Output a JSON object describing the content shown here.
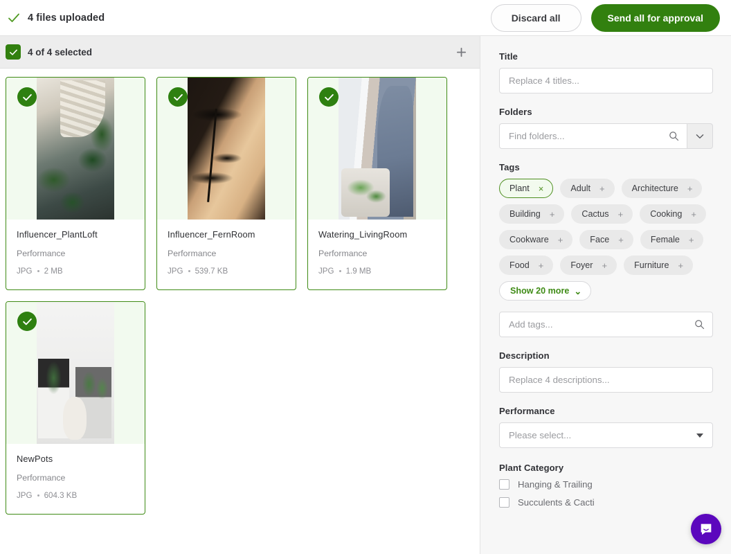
{
  "topbar": {
    "status_text": "4 files uploaded",
    "status_icon": "check-icon",
    "discard_label": "Discard all",
    "send_label": "Send all for approval",
    "accent_green": "#32800f"
  },
  "selection_bar": {
    "label": "4 of 4 selected",
    "checkbox_state": "checked",
    "add_icon": "plus-icon"
  },
  "cards": [
    {
      "title": "Influencer_PlantLoft",
      "subtitle": "Performance",
      "format": "JPG",
      "size": "2 MB",
      "selected": true
    },
    {
      "title": "Influencer_FernRoom",
      "subtitle": "Performance",
      "format": "JPG",
      "size": "539.7 KB",
      "selected": true
    },
    {
      "title": "Watering_LivingRoom",
      "subtitle": "Performance",
      "format": "JPG",
      "size": "1.9 MB",
      "selected": true
    },
    {
      "title": "NewPots",
      "subtitle": "Performance",
      "format": "JPG",
      "size": "604.3 KB",
      "selected": true
    }
  ],
  "panel": {
    "title": {
      "label": "Title",
      "placeholder": "Replace 4 titles..."
    },
    "folders": {
      "label": "Folders",
      "placeholder": "Find folders...",
      "search_icon": "search-icon",
      "caret_icon": "chevron-down-icon"
    },
    "tags": {
      "label": "Tags",
      "items": [
        {
          "name": "Plant",
          "op": "×",
          "selected": true
        },
        {
          "name": "Adult",
          "op": "+",
          "selected": false
        },
        {
          "name": "Architecture",
          "op": "+",
          "selected": false
        },
        {
          "name": "Building",
          "op": "+",
          "selected": false
        },
        {
          "name": "Cactus",
          "op": "+",
          "selected": false
        },
        {
          "name": "Cooking",
          "op": "+",
          "selected": false
        },
        {
          "name": "Cookware",
          "op": "+",
          "selected": false
        },
        {
          "name": "Face",
          "op": "+",
          "selected": false
        },
        {
          "name": "Female",
          "op": "+",
          "selected": false
        },
        {
          "name": "Food",
          "op": "+",
          "selected": false
        },
        {
          "name": "Foyer",
          "op": "+",
          "selected": false
        },
        {
          "name": "Furniture",
          "op": "+",
          "selected": false
        }
      ],
      "show_more_label": "Show 20 more",
      "add_placeholder": "Add tags..."
    },
    "description": {
      "label": "Description",
      "placeholder": "Replace 4 descriptions..."
    },
    "performance": {
      "label": "Performance",
      "placeholder": "Please select..."
    },
    "plant_category": {
      "label": "Plant Category",
      "options": [
        {
          "label": "Hanging & Trailing",
          "checked": false
        },
        {
          "label": "Succulents & Cacti",
          "checked": false
        }
      ]
    }
  },
  "chat_widget": {
    "icon": "chat-bubble-icon",
    "color": "#5b07bd"
  }
}
